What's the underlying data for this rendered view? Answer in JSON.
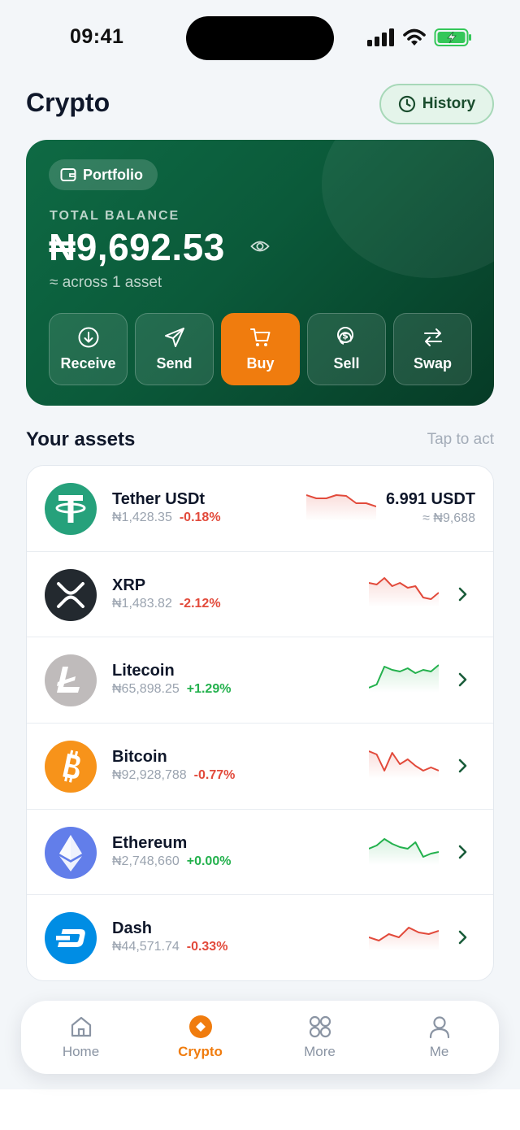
{
  "status_bar": {
    "time": "09:41"
  },
  "header": {
    "title": "Crypto",
    "history_label": "History"
  },
  "portfolio": {
    "chip_label": "Portfolio",
    "balance_label": "TOTAL BALANCE",
    "balance": "₦9,692.53",
    "subtitle": "≈ across 1 asset",
    "actions": [
      {
        "label": "Receive",
        "icon": "arrow-down-circle-icon"
      },
      {
        "label": "Send",
        "icon": "paper-plane-icon"
      },
      {
        "label": "Buy",
        "icon": "cart-icon"
      },
      {
        "label": "Sell",
        "icon": "coin-icon"
      },
      {
        "label": "Swap",
        "icon": "swap-icon"
      }
    ]
  },
  "assets_section": {
    "title": "Your assets",
    "hint": "Tap to act"
  },
  "assets": [
    {
      "name": "Tether USDt",
      "price": "₦1,428.35",
      "change": "-0.18%",
      "trend": "down",
      "holding": "6.991 USDT",
      "holding_value": "≈ ₦9,688",
      "color": "#26a17b",
      "spark": [
        8,
        12,
        12,
        8,
        9,
        18,
        18,
        22
      ]
    },
    {
      "name": "XRP",
      "price": "₦1,483.82",
      "change": "-2.12%",
      "trend": "down",
      "color": "#23292f",
      "spark": [
        10,
        12,
        4,
        14,
        10,
        16,
        14,
        28,
        30,
        22
      ]
    },
    {
      "name": "Litecoin",
      "price": "₦65,898.25",
      "change": "+1.29%",
      "trend": "up",
      "color": "#bfbbbb",
      "spark": [
        34,
        30,
        8,
        12,
        14,
        10,
        16,
        12,
        14,
        6
      ]
    },
    {
      "name": "Bitcoin",
      "price": "₦92,928,788",
      "change": "-0.77%",
      "trend": "down",
      "color": "#f7931a",
      "spark": [
        6,
        10,
        30,
        8,
        22,
        16,
        24,
        30,
        26,
        30
      ]
    },
    {
      "name": "Ethereum",
      "price": "₦2,748,660",
      "change": "+0.00%",
      "trend": "up",
      "color": "#627eea",
      "spark": [
        20,
        16,
        8,
        14,
        18,
        20,
        12,
        30,
        26,
        24
      ]
    },
    {
      "name": "Dash",
      "price": "₦44,571.74",
      "change": "-0.33%",
      "trend": "down",
      "color": "#008de4",
      "spark": [
        24,
        28,
        20,
        24,
        12,
        18,
        20,
        16
      ]
    }
  ],
  "bottom_nav": [
    {
      "label": "Home",
      "icon": "home-icon",
      "active": false
    },
    {
      "label": "Crypto",
      "icon": "crypto-icon",
      "active": true
    },
    {
      "label": "More",
      "icon": "grid-icon",
      "active": false
    },
    {
      "label": "Me",
      "icon": "user-icon",
      "active": false
    }
  ]
}
